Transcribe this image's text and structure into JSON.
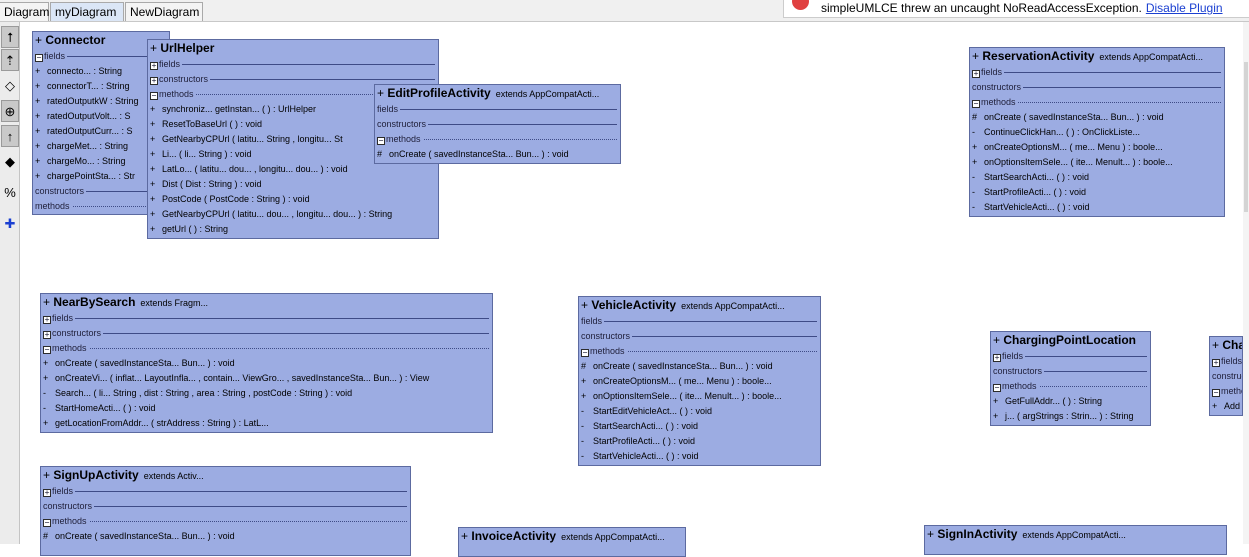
{
  "tabs": {
    "diagram": "Diagram",
    "my_diagram": "myDiagram",
    "new_diagram": "NewDiagram"
  },
  "banner": {
    "message": "simpleUMLCE threw an uncaught NoReadAccessException.",
    "link": "Disable Plugin"
  },
  "toolbar": {
    "icons": [
      "generalization-arrow-icon",
      "implementation-arrow-icon",
      "association-icon",
      "nested-icon",
      "dependency-arrow-icon",
      "composition-icon",
      "percent-assoc-icon",
      "add-class-icon"
    ]
  },
  "labels": {
    "fields": "fields",
    "constructors": "constructors",
    "methods": "methods",
    "plus": "+",
    "minus": "-",
    "hash": "#"
  },
  "classes": {
    "connector": {
      "name": "Connector",
      "members": [
        {
          "v": "+",
          "t": "connecto... : String"
        },
        {
          "v": "+",
          "t": "connectorT... : String"
        },
        {
          "v": "+",
          "t": "ratedOutputkW : String"
        },
        {
          "v": "+",
          "t": "ratedOutputVolt... : S"
        },
        {
          "v": "+",
          "t": "ratedOutputCurr... : S"
        },
        {
          "v": "+",
          "t": "chargeMet... : String"
        },
        {
          "v": "+",
          "t": "chargeMo... : String"
        },
        {
          "v": "+",
          "t": "chargePointSta... : Str"
        }
      ]
    },
    "urlhelper": {
      "name": "UrlHelper",
      "members": [
        {
          "v": "+",
          "t": "synchroniz...   getInstan... ( ) : UrlHelper"
        },
        {
          "v": "+",
          "t": "ResetToBaseUrl ( ) : void"
        },
        {
          "v": "+",
          "t": "GetNearbyCPUrl ( latitu...  String ,  longitu...  St"
        },
        {
          "v": "+",
          "t": "Li... ( li...  String ) : void"
        },
        {
          "v": "+",
          "t": "LatLo... ( latitu...  dou... ,  longitu...  dou... ) : void"
        },
        {
          "v": "+",
          "t": "Dist ( Dist : String ) : void"
        },
        {
          "v": "+",
          "t": "PostCode ( PostCode : String ) : void"
        },
        {
          "v": "+",
          "t": "GetNearbyCPUrl ( latitu...  dou... ,  longitu...  dou... ) : String"
        },
        {
          "v": "+",
          "t": "getUrl ( ) : String"
        }
      ]
    },
    "editprofile": {
      "name": "EditProfileActivity",
      "extends": "extends  AppCompatActi...",
      "members": [
        {
          "v": "#",
          "t": "onCreate ( savedInstanceSta...  Bun... ) : void"
        }
      ]
    },
    "reservation": {
      "name": "ReservationActivity",
      "extends": "extends  AppCompatActi...",
      "members": [
        {
          "v": "#",
          "t": "onCreate ( savedInstanceSta...  Bun... ) : void"
        },
        {
          "v": "-",
          "t": "ContinueClickHan... ( ) : OnClickListe..."
        },
        {
          "v": "+",
          "t": "onCreateOptionsM... ( me...  Menu ) : boole..."
        },
        {
          "v": "+",
          "t": "onOptionsItemSele... ( ite...  Menult... ) : boole..."
        },
        {
          "v": "-",
          "t": "StartSearchActi... ( ) : void"
        },
        {
          "v": "-",
          "t": "StartProfileActi... ( ) : void"
        },
        {
          "v": "-",
          "t": "StartVehicleActi... ( ) : void"
        }
      ]
    },
    "nearby": {
      "name": "NearBySearch",
      "extends": "extends  Fragm...",
      "members": [
        {
          "v": "+",
          "t": "onCreate ( savedInstanceSta...  Bun... ) : void"
        },
        {
          "v": "+",
          "t": "onCreateVi... ( inflat...  LayoutInfla... ,  contain...  ViewGro... ,  savedInstanceSta...  Bun... ) : View"
        },
        {
          "v": "-",
          "t": "Search... ( li...  String ,  dist : String ,  area : String ,  postCode : String ) : void"
        },
        {
          "v": "-",
          "t": "StartHomeActi... ( ) : void"
        },
        {
          "v": "+",
          "t": "getLocationFromAddr... ( strAddress : String ) : LatL..."
        }
      ]
    },
    "vehicle": {
      "name": "VehicleActivity",
      "extends": "extends  AppCompatActi...",
      "members": [
        {
          "v": "#",
          "t": "onCreate ( savedInstanceSta...  Bun... ) : void"
        },
        {
          "v": "+",
          "t": "onCreateOptionsM... ( me...  Menu ) : boole..."
        },
        {
          "v": "+",
          "t": "onOptionsItemSele... ( ite...  Menult... ) : boole..."
        },
        {
          "v": "-",
          "t": "StartEditVehicleAct... ( ) : void"
        },
        {
          "v": "-",
          "t": "StartSearchActi... ( ) : void"
        },
        {
          "v": "-",
          "t": "StartProfileActi... ( ) : void"
        },
        {
          "v": "-",
          "t": "StartVehicleActi... ( ) : void"
        }
      ]
    },
    "chargingpoint": {
      "name": "ChargingPointLocation",
      "members": [
        {
          "v": "+",
          "t": "GetFullAddr... ( ) : String"
        },
        {
          "v": "+",
          "t": "j... ( argStrings : Strin... ) : String"
        }
      ]
    },
    "cha_partial": {
      "name": "Cha",
      "members": [
        {
          "v": "+",
          "t": "Add"
        }
      ]
    },
    "signup": {
      "name": "SignUpActivity",
      "extends": "extends  Activ...",
      "members": [
        {
          "v": "#",
          "t": "onCreate ( savedInstanceSta...  Bun... ) : void"
        }
      ]
    },
    "invoice": {
      "name": "InvoiceActivity",
      "extends": "extends  AppCompatActi..."
    },
    "signin": {
      "name": "SignInActivity",
      "extends": "extends  AppCompatActi..."
    }
  }
}
